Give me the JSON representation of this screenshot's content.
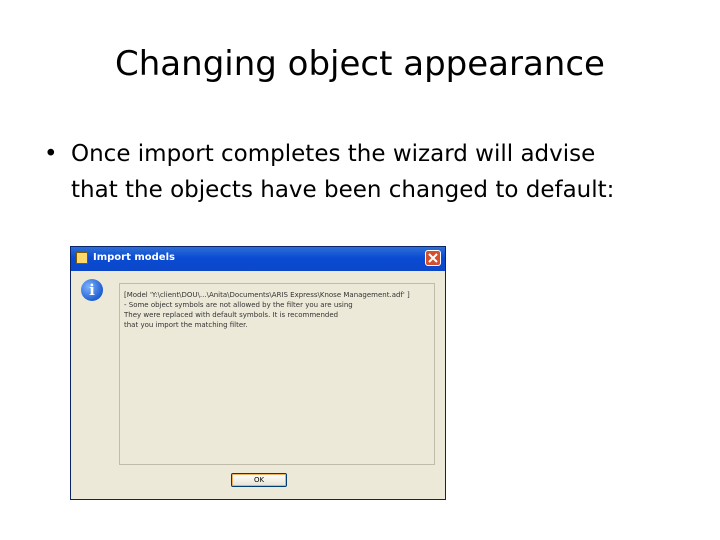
{
  "slide": {
    "title": "Changing object appearance",
    "bullet_symbol": "•",
    "bullet_line1": "Once import completes the wizard will advise",
    "bullet_line2": "that the objects have been changed to default:"
  },
  "dialog": {
    "title": "Import models",
    "app_icon": "folder-icon",
    "close_icon": "close-icon",
    "info_icon": "info-icon",
    "info_glyph": "i",
    "message_lines": [
      "[Model 'Y:\\client\\DOU\\...\\Anita\\Documents\\ARIS Express\\Knose Management.adf' ]",
      "- Some object symbols are not allowed by the filter you are using",
      "  They were replaced with default symbols. It is recommended",
      "that you import the matching filter."
    ],
    "ok_label": "OK"
  },
  "colors": {
    "titlebar": "#0a4bd4",
    "dialog_bg": "#ece9d8",
    "close_button": "#d2502f"
  }
}
